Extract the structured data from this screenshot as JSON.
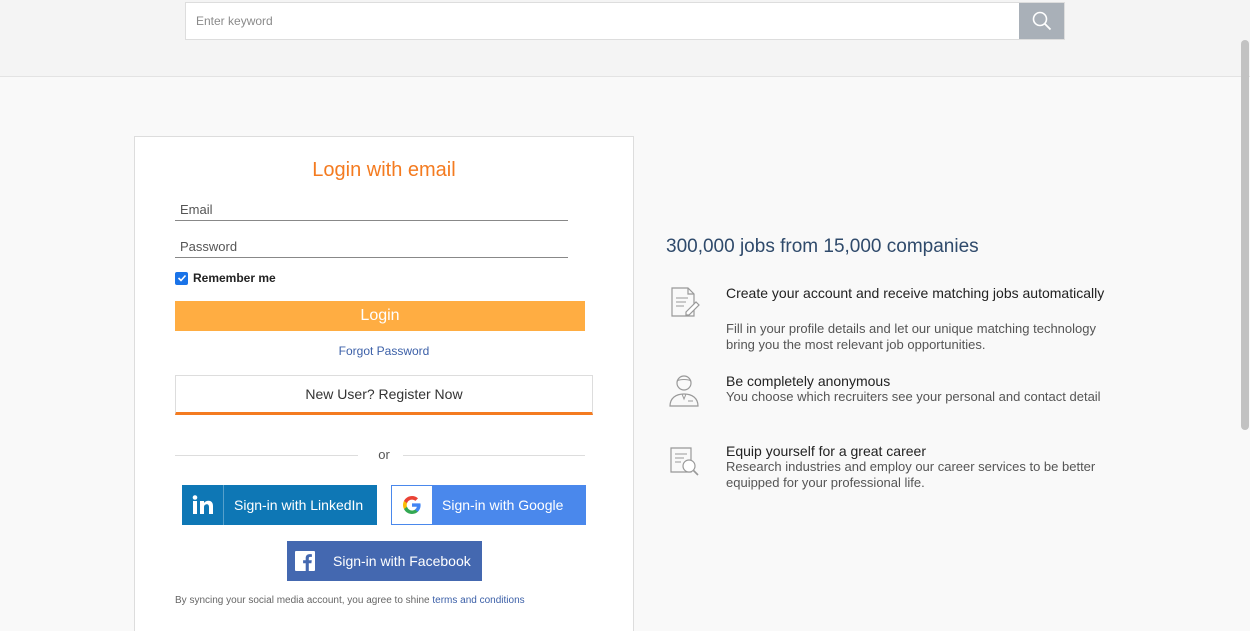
{
  "search": {
    "placeholder": "Enter keyword"
  },
  "login": {
    "title": "Login with email",
    "email_placeholder": "Email",
    "password_placeholder": "Password",
    "remember_label": "Remember me",
    "login_label": "Login",
    "forgot_label": "Forgot Password",
    "register_label": "New User? Register Now",
    "or_label": "or",
    "linkedin_label": "Sign-in with LinkedIn",
    "google_label": "Sign-in with Google",
    "facebook_label": "Sign-in with Facebook",
    "terms_prefix": "By syncing your social media account, you agree to shine",
    "terms_link": "terms and conditions"
  },
  "promo": {
    "headline": "300,000 jobs from 15,000 companies",
    "features": [
      {
        "icon": "document-edit-icon",
        "title": "Create your account and receive matching jobs automatically",
        "desc": "Fill in your profile details and let our unique matching technology bring you the most relevant job opportunities."
      },
      {
        "icon": "user-icon",
        "title": "Be completely anonymous",
        "desc": "You choose which recruiters see your personal and contact detail"
      },
      {
        "icon": "document-search-icon",
        "title": "Equip yourself for a great career",
        "desc": "Research industries and employ our career services to be better equipped for your professional life."
      }
    ]
  },
  "colors": {
    "accent": "#f47b20",
    "login_button": "#ffad42",
    "linkedin": "#0e77b5",
    "google": "#4a88ec",
    "facebook": "#4468b0",
    "link": "#3c60a8"
  }
}
